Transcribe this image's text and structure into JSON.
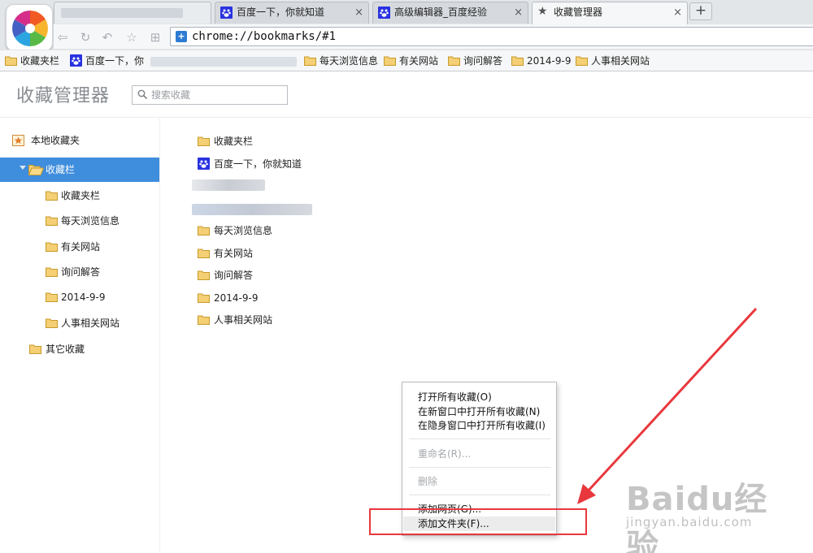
{
  "browser": {
    "tabs": [
      {
        "label": "",
        "blurred": true
      },
      {
        "label": "百度一下，你就知道",
        "icon": "baidu-paw-icon"
      },
      {
        "label": "高级编辑器_百度经验",
        "icon": "baidu-paw-icon"
      },
      {
        "label": "收藏管理器",
        "icon": "star-icon",
        "active": true
      }
    ],
    "close_glyph": "×",
    "new_tab_glyph": "+",
    "url": "chrome://bookmarks/#1",
    "nav_icons": [
      "back-icon",
      "reload-icon",
      "undo-icon",
      "favorite-icon",
      "apps-icon"
    ]
  },
  "bookmarks_bar": [
    {
      "label": "收藏夹栏",
      "icon": "folder-icon"
    },
    {
      "label": "百度一下，你",
      "icon": "baidu-paw-icon"
    },
    {
      "label": "",
      "icon": "blurred"
    },
    {
      "label": "每天浏览信息",
      "icon": "folder-icon"
    },
    {
      "label": "有关网站",
      "icon": "folder-icon"
    },
    {
      "label": "询问解答",
      "icon": "folder-icon"
    },
    {
      "label": "2014-9-9",
      "icon": "folder-icon"
    },
    {
      "label": "人事相关网站",
      "icon": "folder-icon"
    }
  ],
  "manager": {
    "title": "收藏管理器",
    "search_placeholder": "搜索收藏"
  },
  "tree": {
    "root": "本地收藏夹",
    "selected": "收藏栏",
    "children": [
      "收藏夹栏",
      "每天浏览信息",
      "有关网站",
      "询问解答",
      "2014-9-9",
      "人事相关网站"
    ],
    "other": "其它收藏"
  },
  "list": [
    {
      "label": "收藏夹栏",
      "icon": "folder-icon"
    },
    {
      "label": "百度一下，你就知道",
      "icon": "baidu-paw-icon"
    },
    {
      "label": "",
      "icon": "blurred"
    },
    {
      "label": "",
      "icon": "blurred"
    },
    {
      "label": "每天浏览信息",
      "icon": "folder-icon"
    },
    {
      "label": "有关网站",
      "icon": "folder-icon"
    },
    {
      "label": "询问解答",
      "icon": "folder-icon"
    },
    {
      "label": "2014-9-9",
      "icon": "folder-icon"
    },
    {
      "label": "人事相关网站",
      "icon": "folder-icon"
    }
  ],
  "context_menu": {
    "items": [
      {
        "label": "打开所有收藏(O)",
        "enabled": true
      },
      {
        "label": "在新窗口中打开所有收藏(N)",
        "enabled": true
      },
      {
        "label": "在隐身窗口中打开所有收藏(I)",
        "enabled": true
      },
      {
        "label": "重命名(R)...",
        "enabled": false
      },
      {
        "label": "删除",
        "enabled": false
      },
      {
        "label": "添加网页(G)...",
        "enabled": true
      },
      {
        "label": "添加文件夹(F)...",
        "enabled": true,
        "highlighted": true
      }
    ]
  },
  "annotation": {
    "color": "#e8383d"
  },
  "watermark": {
    "logo": "Baidu经验",
    "sub": "jingyan.baidu.com"
  },
  "colors": {
    "selection": "#3f8ddd",
    "folder": "#f2c766",
    "accent_blue": "#2e7bd3"
  }
}
